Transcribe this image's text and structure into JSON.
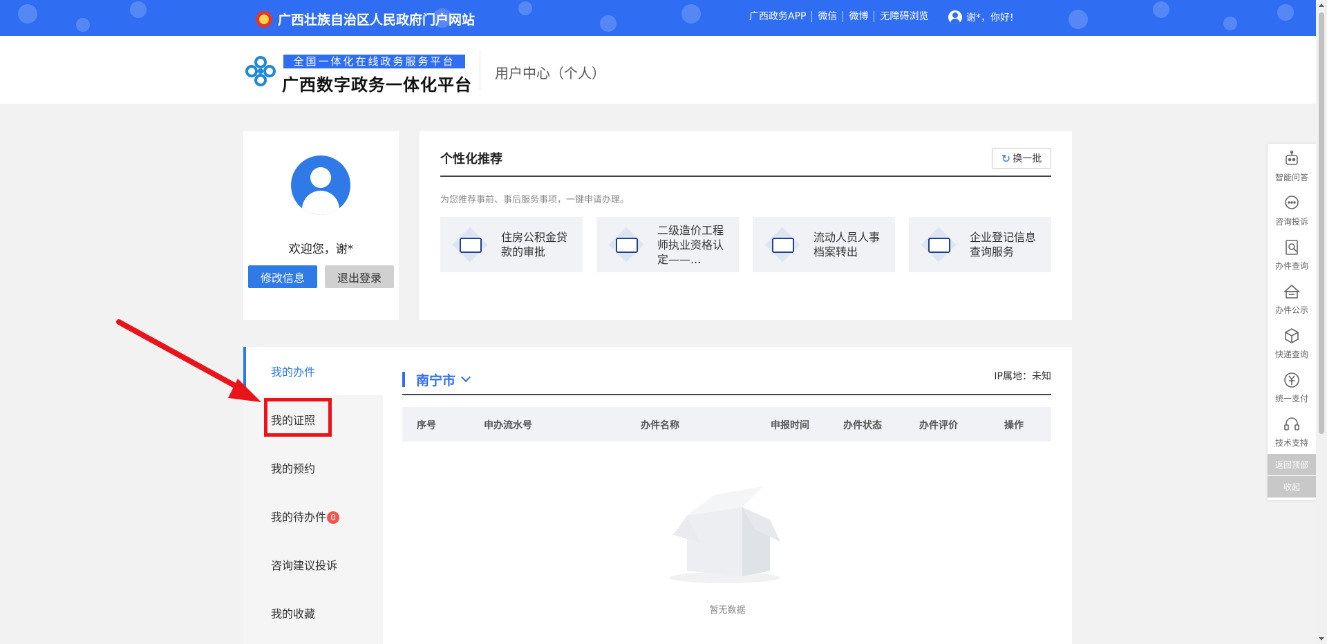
{
  "topbar": {
    "site_title": "广西壮族自治区人民政府门户网站",
    "links": [
      "广西政务APP",
      "微信",
      "微博",
      "无障碍浏览"
    ],
    "user_greeting": "谢*，你好!"
  },
  "header": {
    "brand_top": "全国一体化在线政务服务平台",
    "brand_main": "广西数字政务一体化平台",
    "section": "用户中心（个人）"
  },
  "profile": {
    "welcome": "欢迎您，谢*",
    "edit_label": "修改信息",
    "logout_label": "退出登录"
  },
  "recommend": {
    "title": "个性化推荐",
    "refresh_label": "换一批",
    "subtitle": "为您推荐事前、事后服务事项，一键申请办理。",
    "items": [
      {
        "label": "住房公积金贷款的审批"
      },
      {
        "label": "二级造价工程师执业资格认定——..."
      },
      {
        "label": "流动人员人事档案转出"
      },
      {
        "label": "企业登记信息查询服务"
      }
    ]
  },
  "menu": {
    "items": [
      {
        "label": "我的办件",
        "active": true
      },
      {
        "label": "我的证照"
      },
      {
        "label": "我的预约"
      },
      {
        "label": "我的待办件",
        "badge": "0"
      },
      {
        "label": "咨询建议投诉"
      },
      {
        "label": "我的收藏"
      }
    ]
  },
  "main": {
    "city": "南宁市",
    "ip_area": "IP属地：未知",
    "columns": [
      "序号",
      "申办流水号",
      "办件名称",
      "申报时间",
      "办件状态",
      "办件评价",
      "操作"
    ],
    "empty_text": "暂无数据"
  },
  "float_toolbar": {
    "items": [
      {
        "label": "智能问答",
        "icon": "robot-icon"
      },
      {
        "label": "咨询投诉",
        "icon": "chat-icon"
      },
      {
        "label": "办件查询",
        "icon": "document-search-icon"
      },
      {
        "label": "办件公示",
        "icon": "notice-icon"
      },
      {
        "label": "快递查询",
        "icon": "package-icon"
      },
      {
        "label": "统一支付",
        "icon": "yuan-icon"
      },
      {
        "label": "技术支持",
        "icon": "headset-icon"
      }
    ],
    "back_top": "返回顶部",
    "collapse": "收起"
  },
  "colors": {
    "brand_blue": "#2f6ef2",
    "button_blue": "#2f7ae6",
    "annotation_red": "#e8141a",
    "badge_red": "#f0564e"
  }
}
